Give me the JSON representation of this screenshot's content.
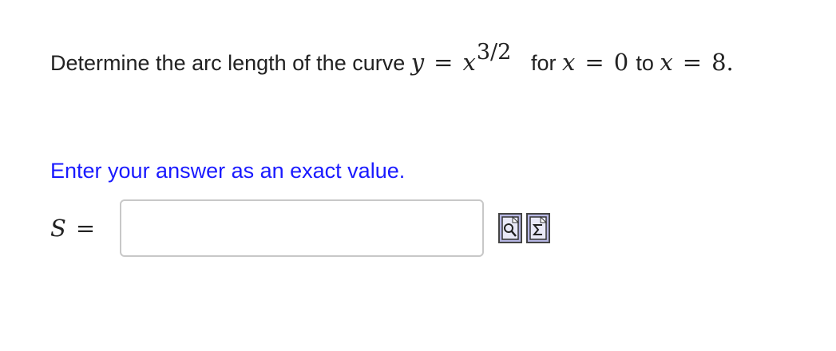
{
  "question": {
    "prefix": "Determine the arc length of the curve",
    "lhs_var": "y",
    "equals": "=",
    "base_var": "x",
    "exponent": "3/2",
    "for_word": "for",
    "range_var_1": "x",
    "range_equals_1": "=",
    "range_start": "0",
    "to_word": "to",
    "range_var_2": "x",
    "range_equals_2": "=",
    "range_end": "8."
  },
  "instruction": "Enter your answer as an exact value.",
  "answer": {
    "label_var": "S",
    "label_equals": "=",
    "value": "",
    "placeholder": ""
  },
  "tools": {
    "preview_icon": "preview-magnifier-icon",
    "equation_icon": "equation-sigma-icon"
  }
}
